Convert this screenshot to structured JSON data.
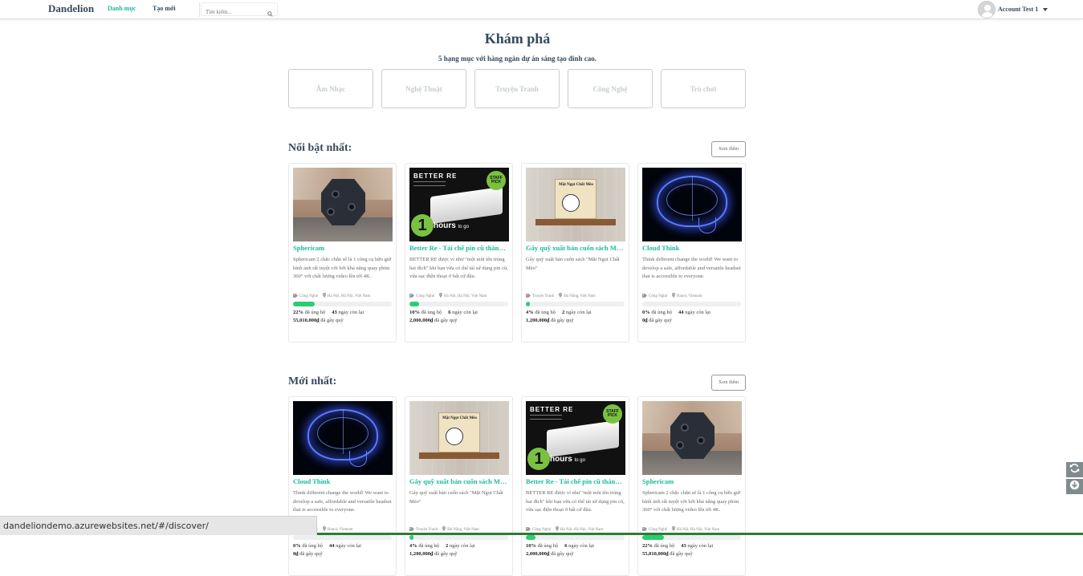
{
  "nav": {
    "brand": "Dandelion",
    "links": [
      {
        "label": "Danh mục"
      },
      {
        "label": "Tạo mới"
      }
    ],
    "search_placeholder": "Tìm kiếm...",
    "account_name": "Account Test 1"
  },
  "discover": {
    "title": "Khám phá",
    "subtitle": "5 hạng mục với hàng ngàn dự án sáng tạo đỉnh cao.",
    "categories": [
      "Âm Nhạc",
      "Nghệ Thuật",
      "Truyện Tranh",
      "Công Nghệ",
      "Trò chơi"
    ]
  },
  "sections": [
    {
      "title": "Nổi bật nhất:",
      "more_label": "Xem thêm",
      "projects": [
        {
          "image": "spherical-camera",
          "title": "Sphericam",
          "desc": "Sphericam 2 chắc chắn sẽ là 1 công cụ hữu giữ hình ảnh rất tuyệt vời bởi khả năng quay phim 360° với chất lượng video lên tới 4K.",
          "category": "Công Nghệ",
          "location": "Hà Nội, Hà Nội, Việt Nam",
          "progress": 0.22,
          "percent": "22%",
          "percent_label": "đã ủng hộ",
          "days": "43",
          "days_label": "ngày còn lại",
          "raised": "55,010,000₫",
          "raised_label": "đã gây quỹ"
        },
        {
          "image": "battery-pack",
          "title": "Better Re - Tái chế pin cũ thành sạc dự phòng",
          "desc": "BETTER RE được ví như \"một mũi tên trúng hai đích\" khi bạn vừa có thể tái sử dụng pin cũ, vừa sạc điện thoại ở bất cứ đâu.",
          "category": "Công Nghệ",
          "location": "Hà Nội, Hà Nội, Việt Nam",
          "progress": 0.1,
          "percent": "10%",
          "percent_label": "đã ủng hộ",
          "days": "6",
          "days_label": "ngày còn lại",
          "raised": "2,000,000₫",
          "raised_label": "đã gây quỹ"
        },
        {
          "image": "book-box",
          "title": "Gây quỹ xuất bản cuốn sách Mặt Ngọt Chất Mèo",
          "desc": "Gây quỹ xuất bản cuốn sách \"Mặt Ngọt Chất Mèo\"",
          "category": "Truyện Tranh",
          "location": "Đà Nẵng, Việt Nam",
          "progress": 0.04,
          "percent": "4%",
          "percent_label": "đã ủng hộ",
          "days": "2",
          "days_label": "ngày còn lại",
          "raised": "1,200,000₫",
          "raised_label": "đã gây quỹ"
        },
        {
          "image": "glowing-brain",
          "title": "Cloud Think",
          "desc": "Think different change the world! We want to develop a safe, affordable and versatile headset that is accessible to everyone.",
          "category": "Công Nghệ",
          "location": "Hanoi, Vietnam",
          "progress": 0.0,
          "percent": "0%",
          "percent_label": "đã ủng hộ",
          "days": "44",
          "days_label": "ngày còn lại",
          "raised": "0₫",
          "raised_label": "đã gây quỹ"
        }
      ]
    },
    {
      "title": "Mới nhất:",
      "more_label": "Xem thêm",
      "projects": [
        {
          "image": "glowing-brain",
          "title": "Cloud Think",
          "desc": "Think different change the world! We want to develop a safe, affordable and versatile headset that is accessible to everyone.",
          "category": "Công Nghệ",
          "location": "Hanoi, Vietnam",
          "progress": 0.0,
          "percent": "0%",
          "percent_label": "đã ủng hộ",
          "days": "44",
          "days_label": "ngày còn lại",
          "raised": "0₫",
          "raised_label": "đã gây quỹ"
        },
        {
          "image": "book-box",
          "title": "Gây quỹ xuất bản cuốn sách Mặt Ngọt Chất Mèo",
          "desc": "Gây quỹ xuất bản cuốn sách \"Mặt Ngọt Chất Mèo\"",
          "category": "Truyện Tranh",
          "location": "Đà Nẵng, Việt Nam",
          "progress": 0.04,
          "percent": "4%",
          "percent_label": "đã ủng hộ",
          "days": "2",
          "days_label": "ngày còn lại",
          "raised": "1,200,000₫",
          "raised_label": "đã gây quỹ"
        },
        {
          "image": "battery-pack",
          "title": "Better Re - Tái chế pin cũ thành sạc dự phòng",
          "desc": "BETTER RE được ví như \"một mũi tên trúng hai đích\" khi bạn vừa có thể tái sử dụng pin cũ, vừa sạc điện thoại ở bất cứ đâu.",
          "category": "Công Nghệ",
          "location": "Hà Nội, Hà Nội, Việt Nam",
          "progress": 0.1,
          "percent": "10%",
          "percent_label": "đã ủng hộ",
          "days": "6",
          "days_label": "ngày còn lại",
          "raised": "2,000,000₫",
          "raised_label": "đã gây quỹ"
        },
        {
          "image": "spherical-camera",
          "title": "Sphericam",
          "desc": "Sphericam 2 chắc chắn sẽ là 1 công cụ hữu giữ hình ảnh rất tuyệt vời bởi khả năng quay phim 360° với chất lượng video lên tới 4K.",
          "category": "Công Nghệ",
          "location": "Hà Nội, Hà Nội, Việt Nam",
          "progress": 0.22,
          "percent": "22%",
          "percent_label": "đã ủng hộ",
          "days": "43",
          "days_label": "ngày còn lại",
          "raised": "55,010,000₫",
          "raised_label": "đã gây quỹ"
        }
      ]
    }
  ],
  "thumb_text": {
    "battery_brand": "BETTER RE",
    "battery_hours": "hours",
    "battery_to_go": "to go",
    "book_label": "Mặt Ngọt Chất Mèo"
  },
  "status_url": "dandeliondemo.azurewebsites.net/#/discover/",
  "colors": {
    "accent": "#1abc9c",
    "progress": "#2ecc71",
    "heading": "#34495e"
  }
}
